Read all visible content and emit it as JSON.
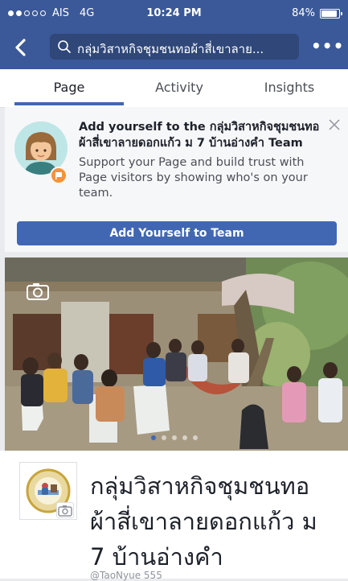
{
  "status_bar": {
    "carrier": "AIS",
    "network": "4G",
    "time": "10:24 PM",
    "battery": "84%"
  },
  "header": {
    "search_text": "กลุ่มวิสาหกิจชุมชนทอผ้าสี่เขาลาย...",
    "more_label": "•••"
  },
  "tabs": [
    {
      "label": "Page",
      "active": true
    },
    {
      "label": "Activity",
      "active": false
    },
    {
      "label": "Insights",
      "active": false
    }
  ],
  "promo": {
    "title": "Add yourself to the กลุ่มวิสาหกิจชุมชนทอผ้าสี่เขาลายดอกแก้ว ม 7  บ้านอ่างคำ Team",
    "body": "Support your Page and build trust with Page visitors by showing who's on your team.",
    "button_label": "Add Yourself to Team"
  },
  "cover": {
    "carousel_total": 5,
    "carousel_current": 1
  },
  "profile": {
    "page_name": "กลุ่มวิสาหกิจชุมชนทอผ้าสี่เขาลายดอกแก้ว ม 7  บ้านอ่างคำ",
    "handle": "@TaoNyue 555"
  },
  "colors": {
    "brand_blue": "#3b5998",
    "button_blue": "#4267b2",
    "badge_orange": "#f7923a"
  }
}
